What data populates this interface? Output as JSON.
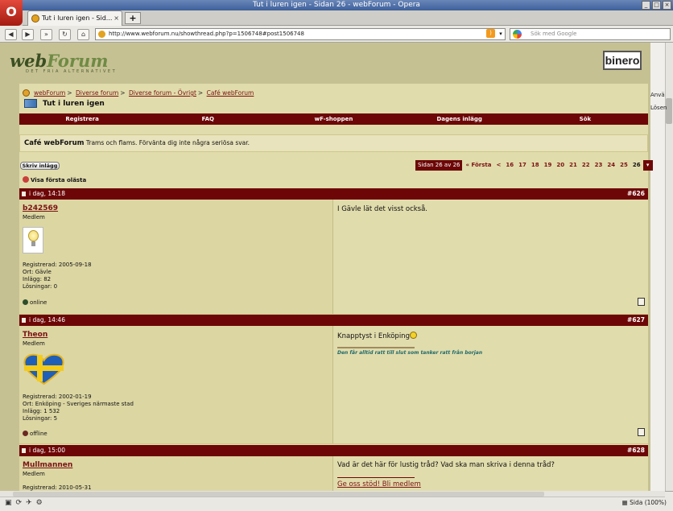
{
  "window": {
    "title": "Tut i luren igen - Sidan 26 - webForum - Opera"
  },
  "browser": {
    "tab_label": "Tut i luren igen - Sid...",
    "url": "http://www.webforum.nu/showthread.php?p=1506748#post1506748",
    "search_placeholder": "Sök med Google",
    "zoom_label": "Sida (100%)"
  },
  "site": {
    "logo_web": "web",
    "logo_forum": "Forum",
    "tagline": "DET FRIA ALTERNATIVET",
    "sponsor": "binero",
    "side_text": [
      "Anvä",
      "Lösen"
    ]
  },
  "breadcrumb": [
    "webForum",
    "Diverse forum",
    "Diverse forum - Övrigt",
    "Café webForum"
  ],
  "thread_title": "Tut i luren igen",
  "nav": [
    "Registrera",
    "FAQ",
    "wF-shoppen",
    "Dagens inlägg",
    "Sök"
  ],
  "forum": {
    "name": "Café webForum",
    "description": "Trams och flams. Förvänta dig inte några seriösa svar."
  },
  "new_post_button": "Skriv inlägg",
  "pager": {
    "current_label": "Sidan 26 av 26",
    "first": "« Första",
    "prev": "<",
    "pages": [
      "16",
      "17",
      "18",
      "19",
      "20",
      "21",
      "22",
      "23",
      "24",
      "25"
    ],
    "active": "26"
  },
  "first_unread": "Visa första olästa",
  "posts": [
    {
      "date": "i dag, 14:18",
      "number": "#626",
      "user": "b242569",
      "role": "Medlem",
      "info": "Registrerad: 2005-09-18\nOrt: Gävle\nInlägg: 82\nLösningar: 0",
      "status": "online",
      "text": "I Gävle lät det visst också."
    },
    {
      "date": "i dag, 14:46",
      "number": "#627",
      "user": "Theon",
      "role": "Medlem",
      "info": "Registrerad: 2002-01-19\nOrt: Enköping - Sveriges närmaste stad\nInlägg: 1 532\nLösningar: 5",
      "status": "offline",
      "text": "Knapptyst i Enköping",
      "signature": "Den får alltid ratt till slut som tanker ratt från borjan"
    },
    {
      "date": "i dag, 15:00",
      "number": "#628",
      "user": "Mullmannen",
      "role": "Medlem",
      "info": "Registrerad: 2010-05-31",
      "text": "Vad är det här för lustig tråd? Vad ska man skriva i denna tråd?",
      "link": "Ge oss stöd! Bli medlem"
    }
  ],
  "colors": {
    "header_bg": "#6d0707",
    "page_bg": "#c6c193",
    "content_bg": "#e1dcac",
    "link": "#7a1212"
  }
}
